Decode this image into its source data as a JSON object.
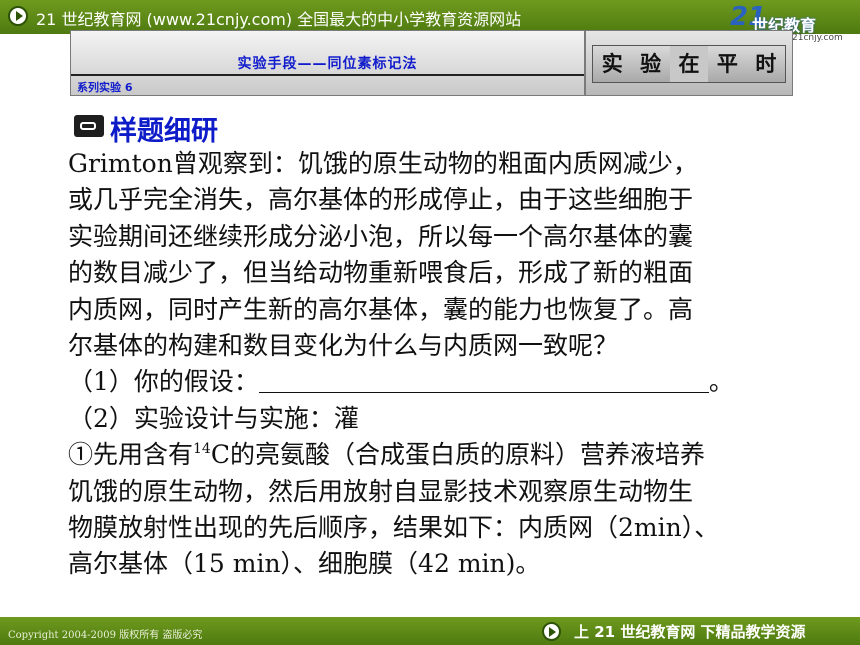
{
  "top_bar": {
    "site_text": "21 世纪教育网 (www.21cnjy.com) 全国最大的中小学教育资源网站"
  },
  "logo": {
    "brand": "21",
    "name": "世纪教育",
    "url": "21cnjy.com"
  },
  "header": {
    "title": "实验手段——同位素标记法",
    "series": "系列实验 6",
    "badge_chars": [
      "实",
      "验",
      "在",
      "平",
      "时"
    ]
  },
  "section": {
    "heading": "样题细研"
  },
  "body": {
    "lines": [
      "Grimton曾观察到：饥饿的原生动物的粗面内质网减少，",
      "或几乎完全消失，高尔基体的形成停止，由于这些细胞于",
      "实验期间还继续形成分泌小泡，所以每一个高尔基体的囊",
      "的数目减少了，但当给动物重新喂食后，形成了新的粗面",
      "内质网，同时产生新的高尔基体，囊的能力也恢复了。高",
      "尔基体的构建和数目变化为什么与内质网一致呢？"
    ],
    "q1_prefix": "（1）你的假设：",
    "q1_suffix": "。",
    "q2": "（2）实验设计与实施：灌",
    "q2_step1_pre": "①先用含有",
    "q2_step1_sup": "14",
    "q2_step1_post": "C的亮氨酸（合成蛋白质的原料）营养液培养",
    "tail_lines": [
      "饥饿的原生动物，然后用放射自显影技术观察原生动物生",
      "物膜放射性出现的先后顺序，结果如下：内质网（2min）、",
      "高尔基体（15 min）、细胞膜（42 min)。"
    ]
  },
  "footer": {
    "copyright": "Copyright 2004-2009 版权所有 盗版必究",
    "slogan": "上 21 世纪教育网   下精品教学资源"
  }
}
